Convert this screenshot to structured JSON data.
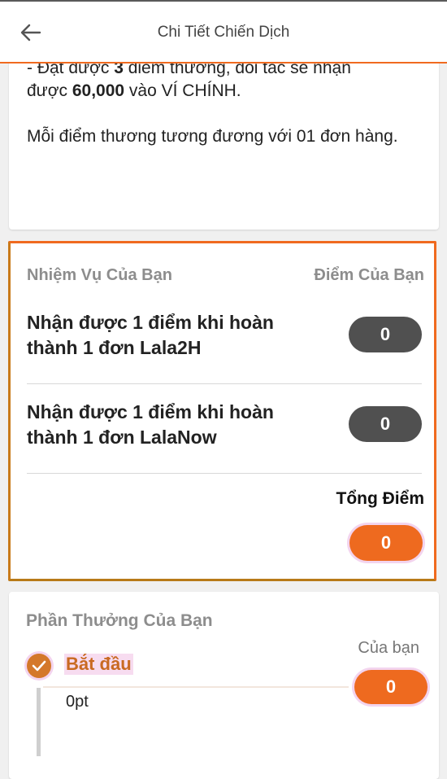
{
  "header": {
    "title": "Chi Tiết Chiến Dịch"
  },
  "description": {
    "line1_pre": "- Đạt được ",
    "line1_points": "3",
    "line1_post": " điểm thưởng, đối tác sẽ nhận",
    "line2_pre": "được ",
    "line2_amount": "60,000",
    "line2_post": " vào VÍ CHÍNH.",
    "paragraph2": "Mỗi điểm thương tương đương với 01 đơn hàng."
  },
  "tasks": {
    "header_left": "Nhiệm Vụ Của Bạn",
    "header_right": "Điểm Của Bạn",
    "items": [
      {
        "label": "Nhận được 1 điểm khi hoàn thành 1 đơn Lala2H",
        "points": "0"
      },
      {
        "label": "Nhận được 1 điểm khi hoàn thành 1 đơn LalaNow",
        "points": "0"
      }
    ],
    "total_label": "Tổng Điểm",
    "total_value": "0"
  },
  "rewards": {
    "title": "Phần Thưởng Của Bạn",
    "your_label": "Của bạn",
    "your_value": "0",
    "milestone_label": "Bắt đầu",
    "milestone_points": "0pt"
  },
  "colors": {
    "accent": "#ee6a1f",
    "pill_dark": "#505050"
  }
}
